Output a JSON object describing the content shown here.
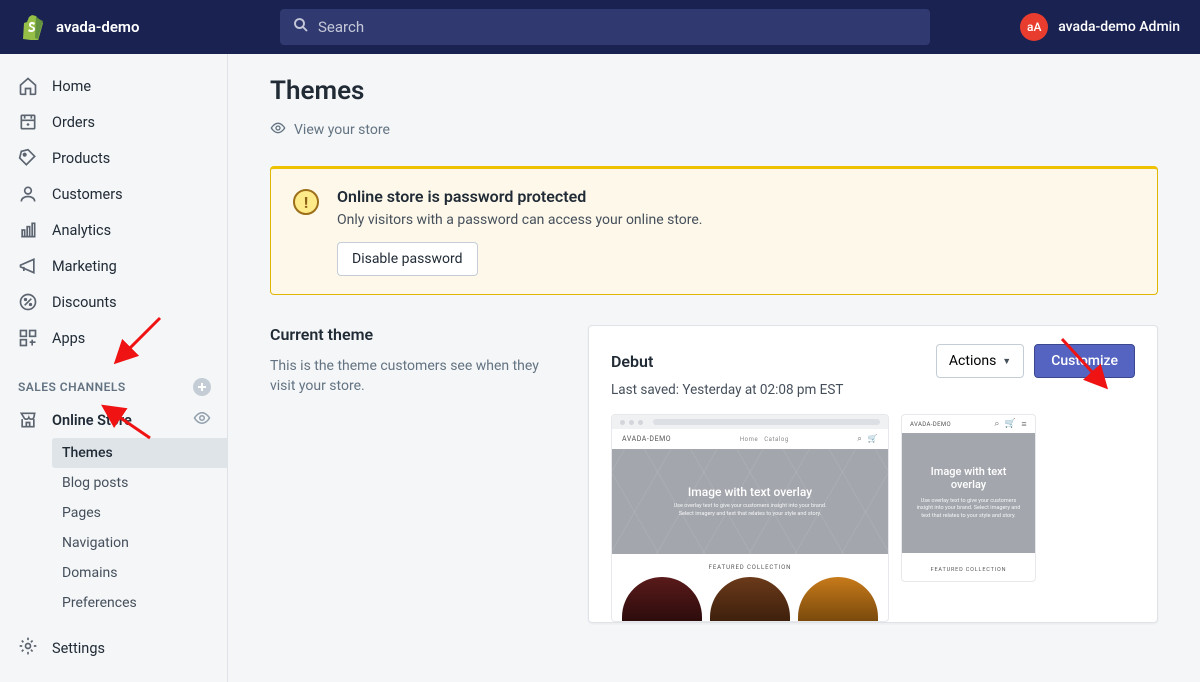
{
  "header": {
    "store_name": "avada-demo",
    "search_placeholder": "Search",
    "avatar_text": "aA",
    "admin_name": "avada-demo Admin"
  },
  "nav": {
    "items": [
      {
        "label": "Home"
      },
      {
        "label": "Orders"
      },
      {
        "label": "Products"
      },
      {
        "label": "Customers"
      },
      {
        "label": "Analytics"
      },
      {
        "label": "Marketing"
      },
      {
        "label": "Discounts"
      },
      {
        "label": "Apps"
      }
    ],
    "section_title": "SALES CHANNELS",
    "channel": "Online Store",
    "sub": [
      {
        "label": "Themes",
        "active": true
      },
      {
        "label": "Blog posts"
      },
      {
        "label": "Pages"
      },
      {
        "label": "Navigation"
      },
      {
        "label": "Domains"
      },
      {
        "label": "Preferences"
      }
    ],
    "settings": "Settings"
  },
  "page": {
    "title": "Themes",
    "view_store": "View your store"
  },
  "banner": {
    "title": "Online store is password protected",
    "subtitle": "Only visitors with a password can access your online store.",
    "button": "Disable password"
  },
  "left": {
    "heading": "Current theme",
    "body": "This is the theme customers see when they visit your store."
  },
  "card": {
    "theme_name": "Debut",
    "last_saved": "Last saved: Yesterday at 02:08 pm EST",
    "actions_label": "Actions",
    "customize_label": "Customize"
  },
  "preview": {
    "brand": "AVADA-DEMO",
    "nav1": "Home",
    "nav2": "Catalog",
    "hero_title": "Image with text overlay",
    "hero_sub1": "Use overlay text to give your customers insight into your brand.",
    "hero_sub2": "Select imagery and text that relates to your style and story.",
    "featured": "FEATURED COLLECTION",
    "mobile_hero_title": "Image with text overlay",
    "mobile_sub": "Use overlay text to give your customers insight into your brand. Select imagery and text that relates to your style and story."
  }
}
